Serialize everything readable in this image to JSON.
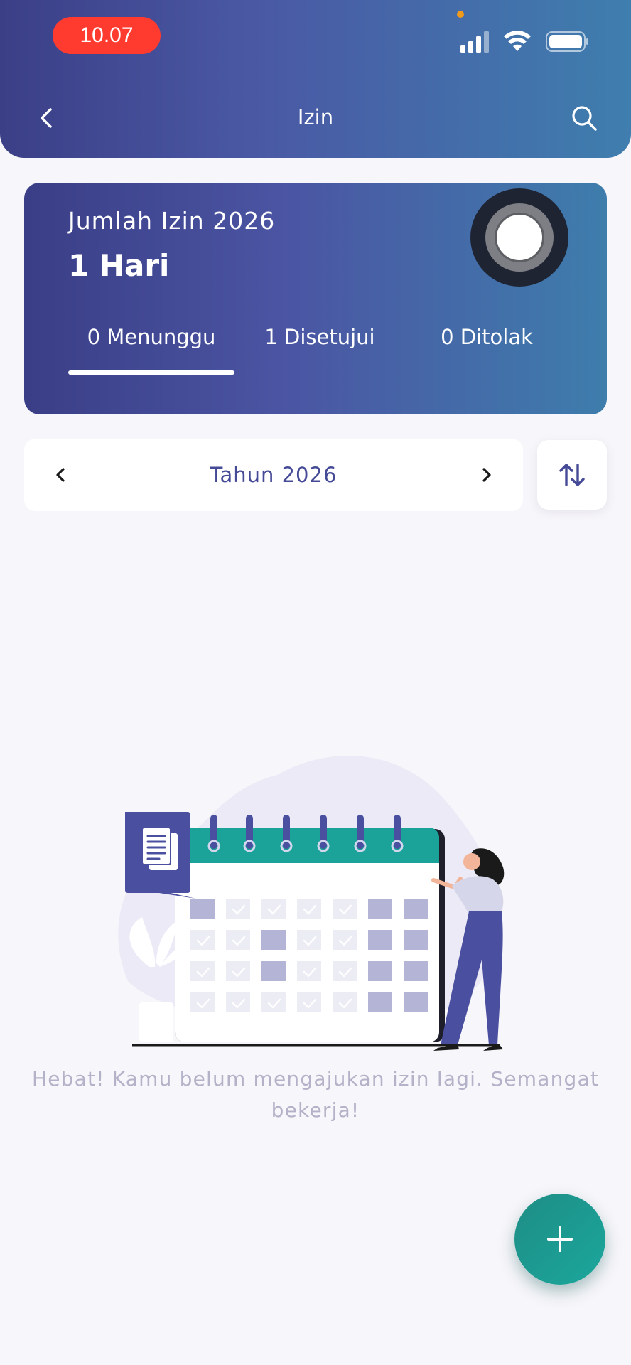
{
  "status_bar": {
    "time": "10.07",
    "icons": [
      "signal-icon",
      "wifi-icon",
      "battery-icon"
    ]
  },
  "header": {
    "title": "Izin",
    "back_icon": "chevron-left-icon",
    "search_icon": "search-icon"
  },
  "summary": {
    "label": "Jumlah Izin 2026",
    "value": "1 Hari",
    "tabs": [
      {
        "label": "0 Menunggu",
        "selected": true
      },
      {
        "label": "1 Disetujui",
        "selected": false
      },
      {
        "label": "0 Ditolak",
        "selected": false
      }
    ]
  },
  "year_selector": {
    "label": "Tahun 2026",
    "prev_icon": "chevron-left-icon",
    "next_icon": "chevron-right-icon",
    "sort_icon": "sort-arrows-icon"
  },
  "empty_state": {
    "message": "Hebat! Kamu belum mengajukan izin lagi. Semangat bekerja!"
  },
  "fab": {
    "icon": "plus-icon"
  },
  "colors": {
    "header_start": "#3b3f86",
    "header_end": "#3f7eae",
    "accent_purple": "#454a96",
    "calendar_teal": "#1ba39a",
    "fab_teal": "#1ba79c",
    "status_time_bg": "#ff3b30",
    "background": "#f7f6fa"
  }
}
